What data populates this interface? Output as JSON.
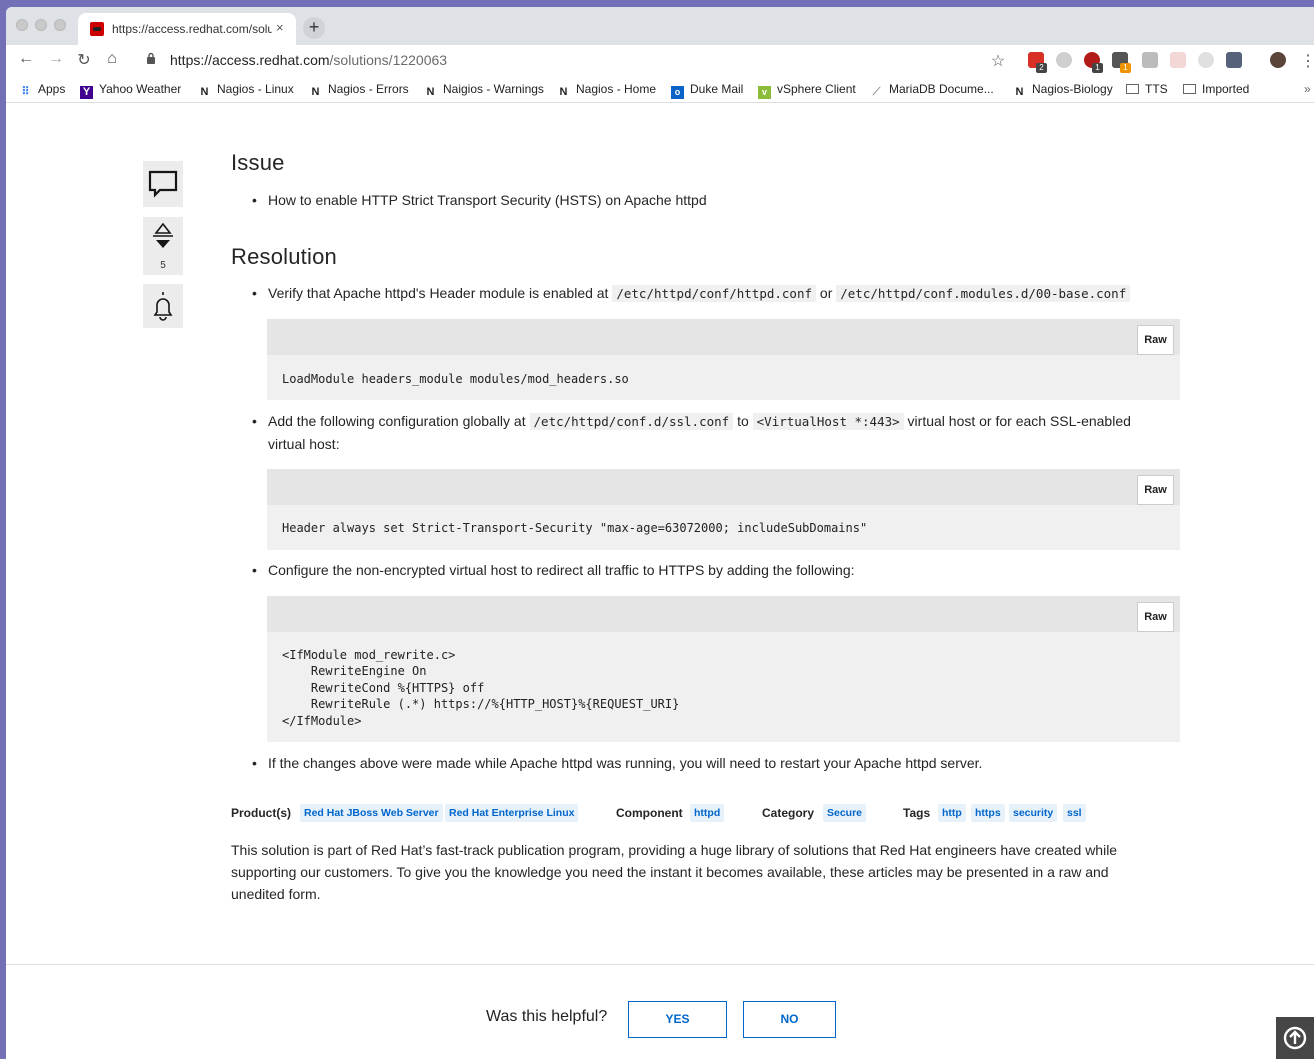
{
  "browser": {
    "tab_title": "https://access.redhat.com/solu",
    "tab_close": "×",
    "new_tab": "+",
    "url_host": "https://access.redhat.com",
    "url_path": "/solutions/1220063",
    "extension_badges": [
      "2",
      "1",
      "1"
    ]
  },
  "bookmarks": [
    {
      "label": "Apps",
      "icon": "apps-grid-icon"
    },
    {
      "label": "Yahoo Weather",
      "icon": "yahoo-icon"
    },
    {
      "label": "Nagios - Linux",
      "icon": "nagios-icon"
    },
    {
      "label": "Nagios - Errors",
      "icon": "nagios-icon"
    },
    {
      "label": "Naigios - Warnings",
      "icon": "nagios-icon"
    },
    {
      "label": "Nagios - Home",
      "icon": "nagios-icon"
    },
    {
      "label": "Duke Mail",
      "icon": "outlook-icon"
    },
    {
      "label": "vSphere Client",
      "icon": "vsphere-icon"
    },
    {
      "label": "MariaDB Docume...",
      "icon": "mariadb-icon"
    },
    {
      "label": "Nagios-Biology",
      "icon": "nagios-icon"
    },
    {
      "label": "TTS",
      "icon": "folder-icon"
    },
    {
      "label": "Imported",
      "icon": "folder-icon"
    }
  ],
  "bookmarks_overflow": "»",
  "sidebar": {
    "rating_count": "5"
  },
  "article": {
    "issue_heading": "Issue",
    "issue_item": "How to enable HTTP Strict Transport Security (HSTS) on Apache httpd",
    "resolution_heading": "Resolution",
    "step1_prefix": "Verify that Apache httpd's Header module is enabled at",
    "step1_code1": "/etc/httpd/conf/httpd.conf",
    "step1_or": "or",
    "step1_code2": "/etc/httpd/conf.modules.d/00-base.conf",
    "code1": "LoadModule headers_module modules/mod_headers.so",
    "step2_prefix": "Add the following configuration globally at",
    "step2_code1": "/etc/httpd/conf.d/ssl.conf",
    "step2_to": "to",
    "step2_code2": "<VirtualHost *:443>",
    "step2_suffix": "virtual host or for each SSL-enabled",
    "step2_line2": "virtual host:",
    "code2": "Header always set Strict-Transport-Security \"max-age=63072000; includeSubDomains\"",
    "step3": "Configure the non-encrypted virtual host to redirect all traffic to HTTPS by adding the following:",
    "code3": "<IfModule mod_rewrite.c>\n    RewriteEngine On\n    RewriteCond %{HTTPS} off\n    RewriteRule (.*) https://%{HTTP_HOST}%{REQUEST_URI}\n</IfModule>",
    "step4": "If the changes above were made while Apache httpd was running, you will need to restart your Apache httpd server.",
    "raw_label": "Raw"
  },
  "metadata": {
    "products_label": "Product(s)",
    "products": [
      "Red Hat JBoss Web Server",
      "Red Hat Enterprise Linux"
    ],
    "component_label": "Component",
    "component": "httpd",
    "category_label": "Category",
    "category": "Secure",
    "tags_label": "Tags",
    "tags": [
      "http",
      "https",
      "security",
      "ssl"
    ]
  },
  "disclaimer": "This solution is part of Red Hat’s fast-track publication program, providing a huge library of solutions that Red Hat engineers have created while supporting our customers. To give you the knowledge you need the instant it becomes available, these articles may be presented in a raw and unedited form.",
  "feedback": {
    "question": "Was this helpful?",
    "yes": "YES",
    "no": "NO"
  }
}
